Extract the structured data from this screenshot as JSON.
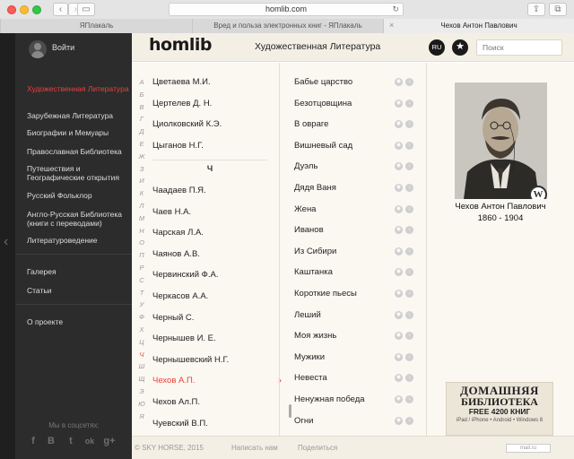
{
  "browser": {
    "url": "homlib.com",
    "tabs": [
      {
        "label": "ЯПлакаль"
      },
      {
        "label": "Вред и польза электронных книг - ЯПлакаль"
      },
      {
        "label": "Чехов Антон Павлович"
      }
    ]
  },
  "sidebar": {
    "login": "Войти",
    "items": [
      {
        "label": "Художественная Литература"
      },
      {
        "label": "Зарубежная Литература"
      },
      {
        "label": "Биографии и Мемуары"
      },
      {
        "label": "Православная Библиотека"
      },
      {
        "label": "Путешествия и Географические открытия"
      },
      {
        "label": "Русский Фольклор"
      },
      {
        "label": "Англо-Русская Библиотека (книги с переводами)"
      },
      {
        "label": "Литературоведение"
      },
      {
        "label": "Галерея"
      },
      {
        "label": "Статьи"
      },
      {
        "label": "О проекте"
      }
    ],
    "social_title": "Мы в соцсетях:",
    "social": [
      "f",
      "B",
      "t",
      "ok",
      "g+"
    ]
  },
  "header": {
    "logo": "homlib",
    "section_title": "Художественная Литература",
    "lang": "RU",
    "search_placeholder": "Поиск"
  },
  "alphabet": [
    "А",
    "Б",
    "В",
    "Г",
    "Д",
    "Е",
    "Ж",
    "З",
    "И",
    "К",
    "Л",
    "М",
    "Н",
    "О",
    "П",
    "Р",
    "С",
    "Т",
    "У",
    "Ф",
    "Х",
    "Ц",
    "Ч",
    "Ш",
    "Щ",
    "Э",
    "Ю",
    "Я"
  ],
  "authors_before": [
    "Цветаева М.И.",
    "Цертелев Д. Н.",
    "Циолковский К.Э.",
    "Цыганов Н.Г."
  ],
  "group_letter": "Ч",
  "authors_after": [
    "Чаадаев П.Я.",
    "Чаев Н.А.",
    "Чарская Л.А.",
    "Чаянов А.В.",
    "Червинский Ф.А.",
    "Черкасов А.А.",
    "Черный С.",
    "Чернышев И. Е.",
    "Чернышевский Н.Г.",
    "Чехов А.П.",
    "Чехов Ал.П.",
    "Чуевский В.П."
  ],
  "books": [
    "Бабье царство",
    "Безотцовщина",
    "В овраге",
    "Вишневый сад",
    "Дуэль",
    "Дядя Ваня",
    "Жена",
    "Иванов",
    "Из Сибири",
    "Каштанка",
    "Короткие пьесы",
    "Леший",
    "Моя жизнь",
    "Мужики",
    "Невеста",
    "Ненужная победа",
    "Огни"
  ],
  "author_panel": {
    "name": "Чехов Антон Павлович",
    "years": "1860 - 1904",
    "wiki": "W"
  },
  "ad": {
    "line1": "ДОМАШНЯЯ",
    "line2": "БИБЛИОТЕКА",
    "line3": "FREE 4200 КНИГ",
    "line4": "iPad / iPhone • Android • Windows 8"
  },
  "footer": {
    "copyright": "© SKY HORSE, 2015",
    "write": "Написать нам",
    "share": "Поделиться",
    "counter": "mail.ru"
  }
}
